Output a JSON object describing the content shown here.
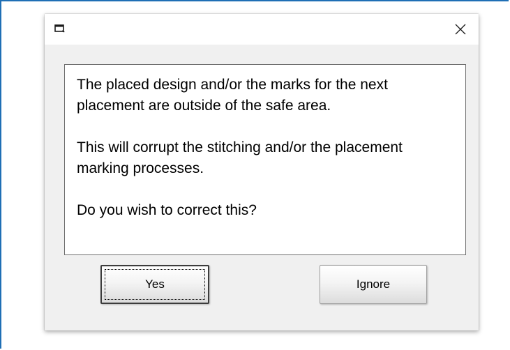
{
  "dialog": {
    "title": "",
    "app_icon": "window-icon",
    "close_icon": "close-icon",
    "message_paragraphs": [
      "The placed design and/or the marks for the next placement are outside of the safe area.",
      "This will corrupt the stitching and/or the placement marking processes.",
      "Do you wish to correct this?"
    ],
    "buttons": {
      "yes_label": "Yes",
      "ignore_label": "Ignore"
    }
  },
  "colors": {
    "frame_border": "#1f6fb5",
    "dialog_background": "#f0f0f0",
    "message_background": "#ffffff"
  }
}
